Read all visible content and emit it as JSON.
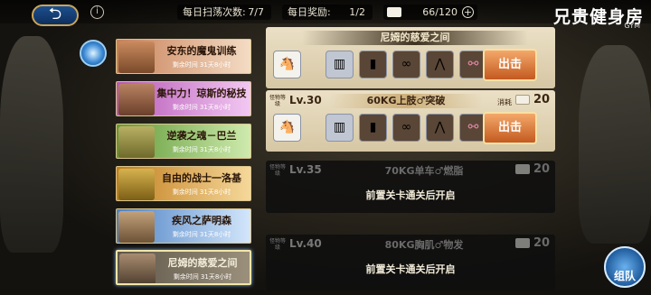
{
  "topbar": {
    "daily_sweep_label": "每日扫荡次数:",
    "daily_sweep_value": "7/7",
    "daily_reward_label": "每日奖励:",
    "daily_reward_value": "1/2",
    "currency_value": "66/120",
    "currency_add": "+",
    "back_icon": "back-arrow-icon",
    "info_icon": "i"
  },
  "brand": {
    "title": "兄贵健身房",
    "subtitle": "GYM"
  },
  "quests": [
    {
      "title": "安东的魔鬼训练",
      "time": "剩余时间 31天8小时",
      "color": "#e2a07a"
    },
    {
      "title": "集中力！琼斯的秘技",
      "time": "剩余时间 31天8小时",
      "color": "#d880d8"
    },
    {
      "title": "逆袭之魂－巴兰",
      "time": "剩余时间 31天8小时",
      "color": "#8fcf5a"
    },
    {
      "title": "自由的战士一洛基",
      "time": "剩余时间 31天8小时",
      "color": "#e7a83d"
    },
    {
      "title": "疾风之萨明森",
      "time": "剩余时间 31天8小时",
      "color": "#7fb0e8"
    },
    {
      "title": "尼姆的慈爱之间",
      "time": "剩余时间 31天8小时",
      "color": "#a59682"
    }
  ],
  "stages": [
    {
      "ribbon": "尼姆的慈爱之间",
      "attack": "出击"
    },
    {
      "difficulty": "怪物等级",
      "level": "Lv.30",
      "name": "60KG上肢♂突破",
      "cost_label": "消耗",
      "cost": "20",
      "attack": "出击"
    }
  ],
  "locked_stages": [
    {
      "difficulty": "怪物等级",
      "level": "Lv.35",
      "name": "70KG单车♂燃脂",
      "cost": "20",
      "unlock": "前置关卡通关后开启"
    },
    {
      "difficulty": "怪物等级",
      "level": "Lv.40",
      "name": "80KG胸肌♂物发",
      "cost": "20",
      "unlock": "前置关卡通关后开启"
    }
  ],
  "team_button": {
    "label": "组队"
  },
  "colors": {
    "gold": "#d9c48c",
    "attack": "#c35a20",
    "panel": "#e8dcc0"
  }
}
